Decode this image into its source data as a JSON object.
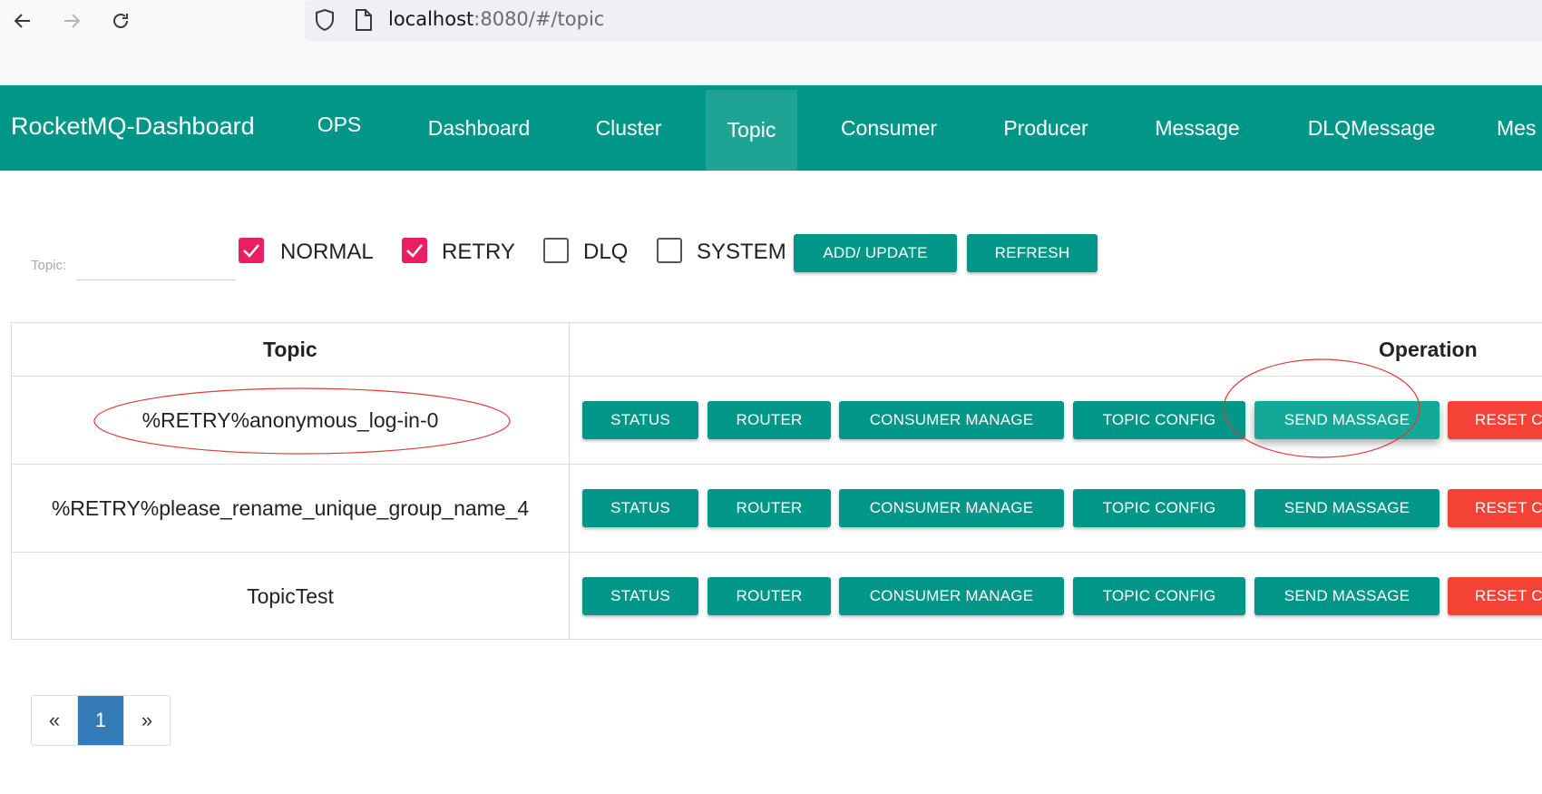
{
  "browser": {
    "url_host": "localhost",
    "url_path": ":8080/#/topic"
  },
  "navbar": {
    "brand": "RocketMQ-Dashboard",
    "items": [
      "OPS",
      "Dashboard",
      "Cluster",
      "Topic",
      "Consumer",
      "Producer",
      "Message",
      "DLQMessage",
      "Mes"
    ],
    "active": "Topic"
  },
  "filter": {
    "topic_label": "Topic:",
    "topic_value": "",
    "checkboxes": [
      {
        "label": "NORMAL",
        "checked": true
      },
      {
        "label": "RETRY",
        "checked": true
      },
      {
        "label": "DLQ",
        "checked": false
      },
      {
        "label": "SYSTEM",
        "checked": false
      }
    ],
    "add_update_label": "ADD/ UPDATE",
    "refresh_label": "REFRESH"
  },
  "table": {
    "headers": {
      "topic": "Topic",
      "operation": "Operation"
    },
    "rows": [
      {
        "topic": "%RETRY%anonymous_log-in-0"
      },
      {
        "topic": "%RETRY%please_rename_unique_group_name_4"
      },
      {
        "topic": "TopicTest"
      }
    ],
    "operations": {
      "status": "STATUS",
      "router": "ROUTER",
      "consumer_manage": "CONSUMER MANAGE",
      "topic_config": "TOPIC CONFIG",
      "send_message": "SEND MASSAGE",
      "reset": "RESET C"
    }
  },
  "pagination": {
    "prev": "«",
    "current": "1",
    "next": "»"
  },
  "colors": {
    "primary": "#009688",
    "danger": "#f44336",
    "checkbox": "#e91e63",
    "page_active": "#337ab7",
    "annotation": "#e03a3a"
  }
}
